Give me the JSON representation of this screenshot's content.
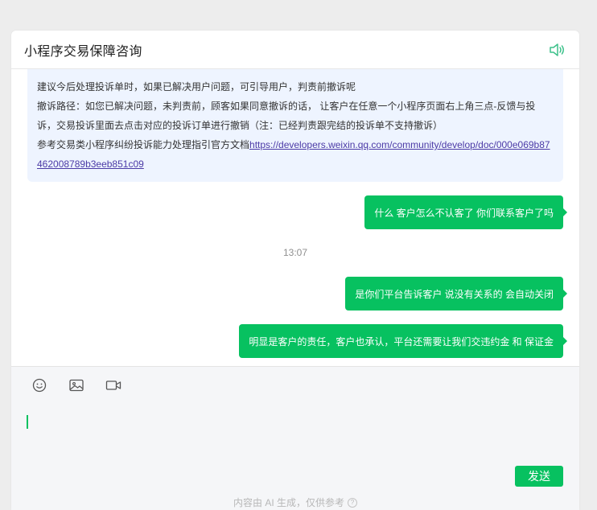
{
  "header": {
    "title": "小程序交易保障咨询",
    "speaker_icon": "speaker-icon"
  },
  "notice": {
    "line1": "建议今后处理投诉单时，如果已解决用户问题，可引导用户，判责前撤诉呢",
    "line2": "撤诉路径：如您已解决问题，未判责前，顾客如果同意撤诉的话， 让客户在任意一个小程序页面右上角三点-反馈与投诉，交易投诉里面去点击对应的投诉订单进行撤销（注：已经判责跟完结的投诉单不支持撤诉）",
    "line3_prefix": "参考交易类小程序纠纷投诉能力处理指引官方文档",
    "link": "https://developers.weixin.qq.com/community/develop/doc/000e069b87462008789b3eeb851c09"
  },
  "messages": [
    {
      "text": "什么 客户怎么不认客了 你们联系客户了吗"
    },
    {
      "text": "是你们平台告诉客户 说没有关系的 会自动关闭"
    },
    {
      "text": "明显是客户的责任，客户也承认，平台还需要让我们交违约金 和 保证金"
    }
  ],
  "timestamp": "13:07",
  "composer": {
    "emoji_icon": "emoji-icon",
    "image_icon": "image-icon",
    "video_icon": "video-icon",
    "send_label": "发送",
    "disclaimer": "内容由 AI 生成，仅供参考"
  },
  "colors": {
    "accent": "#07c160",
    "notice_bg": "#eef4ff",
    "page_bg": "#ededed"
  }
}
